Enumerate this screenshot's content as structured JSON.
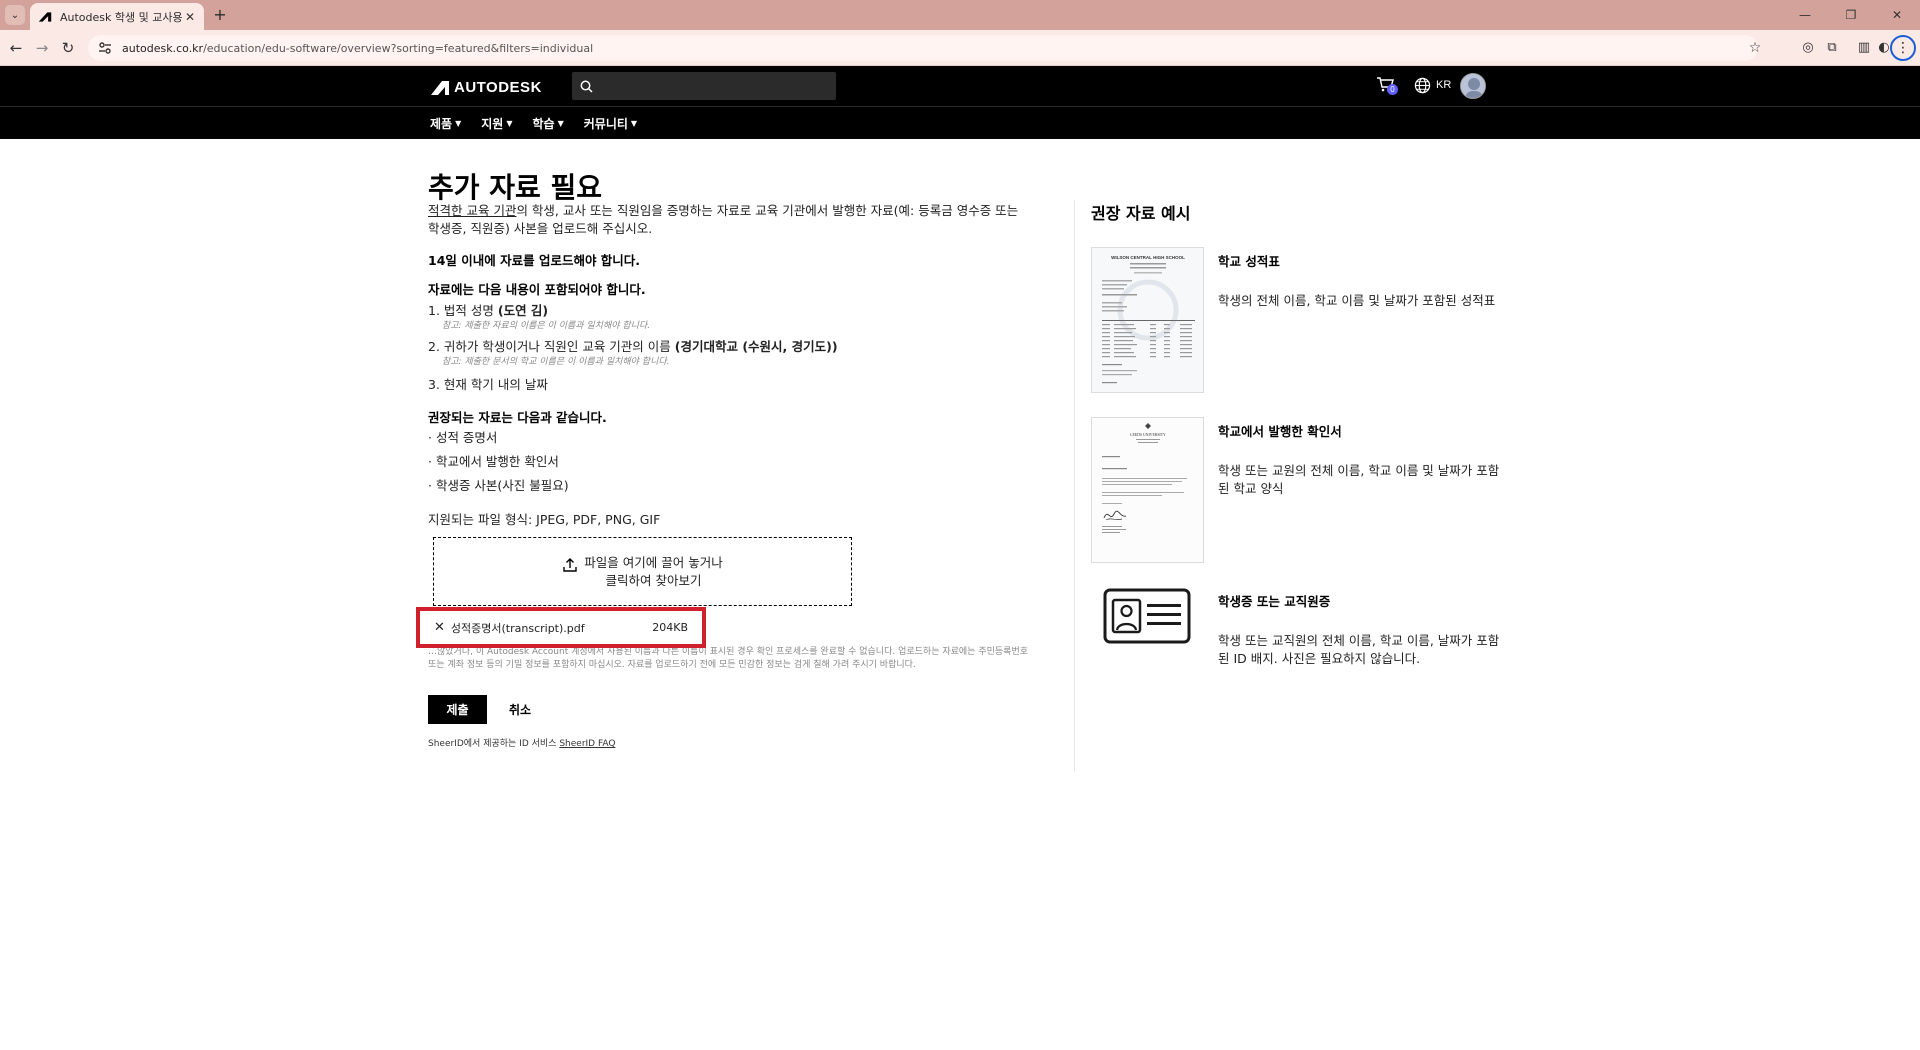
{
  "browser": {
    "tab_title": "Autodesk 학생 및 교사용 액세",
    "url_domain": "autodesk.co.kr",
    "url_path": "/education/edu-software/overview?sorting=featured&filters=individual"
  },
  "header": {
    "logo_text": "AUTODESK",
    "search_placeholder": "",
    "cart_count": "0",
    "language": "KR"
  },
  "nav": {
    "items": [
      {
        "label": "제품"
      },
      {
        "label": "지원"
      },
      {
        "label": "학습"
      },
      {
        "label": "커뮤니티"
      }
    ]
  },
  "main": {
    "title": "추가 자료 필요",
    "intro_link": "적격한 교육 기관",
    "intro_rest": "의 학생, 교사 또는 직원임을 증명하는 자료로 교육 기관에서 발행한 자료(예: 등록금 영수증 또는 학생증, 직원증) 사본을 업로드해 주십시오.",
    "deadline": "14일 이내에 자료를 업로드해야 합니다.",
    "must_include_heading": "자료에는 다음 내용이 포함되어야 합니다.",
    "requirements": [
      {
        "text_prefix": "1. 법적 성명 ",
        "text_bold": "(도연 김)",
        "note": "참고: 제출한 자료의 이름은 이 이름과 일치해야 합니다."
      },
      {
        "text_prefix": "2. 귀하가 학생이거나 직원인 교육 기관의 이름 ",
        "text_bold": "(경기대학교 (수원시, 경기도))",
        "note": "참고: 제출한 문서의 학교 이름은 이 이름과 일치해야 합니다."
      },
      {
        "text_prefix": "3. 현재 학기 내의 날짜",
        "text_bold": "",
        "note": ""
      }
    ],
    "recommended_heading": "권장되는 자료는 다음과 같습니다.",
    "recommended": [
      "· 성적 증명서",
      "· 학교에서 발행한 확인서",
      "· 학생증 사본(사진 불필요)"
    ],
    "formats": "지원되는 파일 형식: JPEG, PDF, PNG, GIF",
    "dropzone_text": "파일을 여기에 끌어 놓거나 클릭하여 찾아보기",
    "file": {
      "name": "성적증명서(transcript).pdf",
      "size": "204KB"
    },
    "disclaimer": "…않았거나, 이 Autodesk Account 계정에서 사용된 이름과 다른 이름이 표시된 경우 확인 프로세스를 완료할 수 없습니다. 업로드하는 자료에는 주민등록번호 또는 계좌 정보 등의 기밀 정보를 포함하지 마십시오. 자료를 업로드하기 전에 모든 민감한 정보는 검게 칠해 가려 주시기 바랍니다.",
    "submit_label": "제출",
    "cancel_label": "취소",
    "sheerid_text": "SheerID에서 제공하는 ID 서비스 ",
    "sheerid_faq": "SheerID FAQ"
  },
  "side": {
    "title": "권장 자료 예시",
    "examples": [
      {
        "title": "학교 성적표",
        "desc": "학생의 전체 이름, 학교 이름 및 날짜가 포함된 성적표",
        "thumb_heading": "WILSON CENTRAL HIGH SCHOOL"
      },
      {
        "title": "학교에서 발행한 확인서",
        "desc": "학생 또는 교원의 전체 이름, 학교 이름 및 날짜가 포함된 학교 양식",
        "thumb_heading": "LEEDS UNIVERSITY"
      },
      {
        "title": "학생증 또는 교직원증",
        "desc": "학생 또는 교직원의 전체 이름, 학교 이름, 날짜가 포함된 ID 배지. 사진은 필요하지 않습니다."
      }
    ]
  },
  "colors": {
    "header_bg": "#000000",
    "highlight": "#d0202c",
    "tabbar": "#d3a29b",
    "cart_badge": "#5f60ff"
  }
}
